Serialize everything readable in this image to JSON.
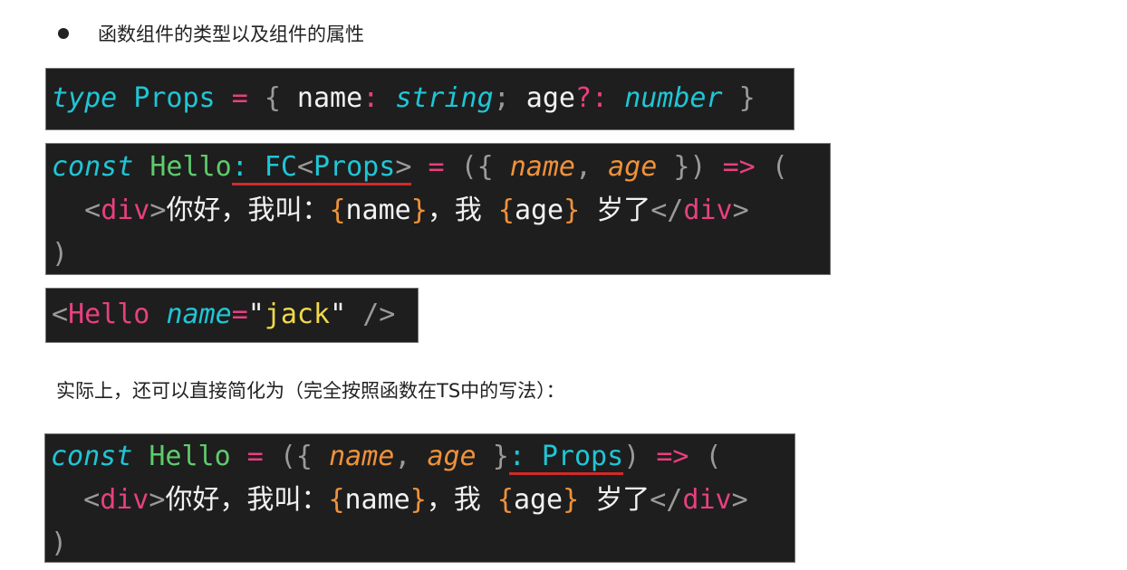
{
  "heading": "函数组件的类型以及组件的属性",
  "paragraph": "实际上，还可以直接简化为（完全按照函数在TS中的写法）：",
  "colors": {
    "keyword": "#1fc6d6",
    "operator": "#ea3f7f",
    "function": "#5fcb6c",
    "param": "#f0923a",
    "string": "#f1d94a",
    "underline": "#d22a2a",
    "background": "#1e1e1e"
  },
  "blocks": [
    {
      "lines": [
        [
          [
            "type",
            "kw"
          ],
          [
            " ",
            "tx"
          ],
          [
            "Props",
            "ty"
          ],
          [
            " ",
            "tx"
          ],
          [
            "=",
            "op"
          ],
          [
            " ",
            "tx"
          ],
          [
            "{",
            "pu"
          ],
          [
            " name",
            "tx"
          ],
          [
            ":",
            "op"
          ],
          [
            " ",
            "tx"
          ],
          [
            "string",
            "tyi"
          ],
          [
            ";",
            "pu"
          ],
          [
            " age",
            "tx"
          ],
          [
            "?:",
            "op"
          ],
          [
            " ",
            "tx"
          ],
          [
            "number",
            "tyi"
          ],
          [
            " ",
            "tx"
          ],
          [
            "}",
            "pu"
          ]
        ]
      ]
    },
    {
      "lines": [
        [
          [
            "const",
            "kw"
          ],
          [
            " ",
            "tx"
          ],
          [
            "Hello",
            "fn"
          ],
          [
            ": FC",
            "ty ul"
          ],
          [
            "<",
            "pu ul"
          ],
          [
            "Props",
            "ty ul"
          ],
          [
            ">",
            "pu ul"
          ],
          [
            " ",
            "tx"
          ],
          [
            "=",
            "op"
          ],
          [
            " ",
            "tx"
          ],
          [
            "({",
            "pu"
          ],
          [
            " ",
            "tx"
          ],
          [
            "name",
            "pa"
          ],
          [
            ",",
            "pu"
          ],
          [
            " ",
            "tx"
          ],
          [
            "age",
            "pa"
          ],
          [
            " ",
            "tx"
          ],
          [
            "})",
            "pu"
          ],
          [
            " ",
            "tx"
          ],
          [
            "=>",
            "op"
          ],
          [
            " ",
            "tx"
          ],
          [
            "(",
            "pu"
          ]
        ],
        [
          [
            "  ",
            "tx"
          ],
          [
            "<",
            "pu"
          ],
          [
            "div",
            "tg"
          ],
          [
            ">",
            "pu"
          ],
          [
            "你好，我叫：",
            "tx"
          ],
          [
            "{",
            "br"
          ],
          [
            "name",
            "tx"
          ],
          [
            "}",
            "br"
          ],
          [
            "，我 ",
            "tx"
          ],
          [
            "{",
            "br"
          ],
          [
            "age",
            "tx"
          ],
          [
            "}",
            "br"
          ],
          [
            " 岁了",
            "tx"
          ],
          [
            "</",
            "pu"
          ],
          [
            "div",
            "tg"
          ],
          [
            ">",
            "pu"
          ]
        ],
        [
          [
            ")",
            "pu"
          ]
        ]
      ]
    },
    {
      "lines": [
        [
          [
            "<",
            "pu"
          ],
          [
            "Hello",
            "tg"
          ],
          [
            " ",
            "tx"
          ],
          [
            "name",
            "kw"
          ],
          [
            "=",
            "op"
          ],
          [
            "\"",
            "tx"
          ],
          [
            "jack",
            "st"
          ],
          [
            "\"",
            "tx"
          ],
          [
            " ",
            "tx"
          ],
          [
            "/>",
            "pu"
          ]
        ]
      ]
    },
    {
      "lines": [
        [
          [
            "const",
            "kw"
          ],
          [
            " ",
            "tx"
          ],
          [
            "Hello",
            "fn"
          ],
          [
            " ",
            "tx"
          ],
          [
            "=",
            "op"
          ],
          [
            " ",
            "tx"
          ],
          [
            "({",
            "pu"
          ],
          [
            " ",
            "tx"
          ],
          [
            "name",
            "pa"
          ],
          [
            ",",
            "pu"
          ],
          [
            " ",
            "tx"
          ],
          [
            "age",
            "pa"
          ],
          [
            " ",
            "tx"
          ],
          [
            "}",
            "pu"
          ],
          [
            ": Props",
            "ty ul"
          ],
          [
            ")",
            "pu"
          ],
          [
            " ",
            "tx"
          ],
          [
            "=>",
            "op"
          ],
          [
            " ",
            "tx"
          ],
          [
            "(",
            "pu"
          ]
        ],
        [
          [
            "  ",
            "tx"
          ],
          [
            "<",
            "pu"
          ],
          [
            "div",
            "tg"
          ],
          [
            ">",
            "pu"
          ],
          [
            "你好，我叫：",
            "tx"
          ],
          [
            "{",
            "br"
          ],
          [
            "name",
            "tx"
          ],
          [
            "}",
            "br"
          ],
          [
            "，我 ",
            "tx"
          ],
          [
            "{",
            "br"
          ],
          [
            "age",
            "tx"
          ],
          [
            "}",
            "br"
          ],
          [
            " 岁了",
            "tx"
          ],
          [
            "</",
            "pu"
          ],
          [
            "div",
            "tg"
          ],
          [
            ">",
            "pu"
          ]
        ],
        [
          [
            ")",
            "pu"
          ]
        ]
      ]
    }
  ]
}
